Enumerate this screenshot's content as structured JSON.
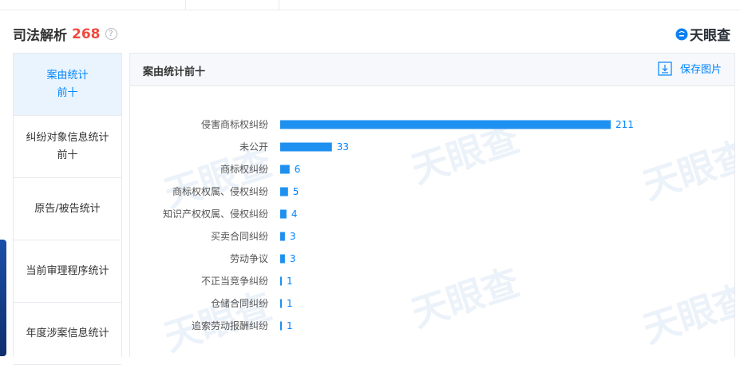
{
  "header": {
    "title": "司法解析",
    "count": "268",
    "help_glyph": "?",
    "brand_name": "天眼查",
    "brand_icon": "tianyancha-logo-icon"
  },
  "sidebar": {
    "items": [
      {
        "label": "案由统计\n前十",
        "active": true
      },
      {
        "label": "纠纷对象信息统计\n前十",
        "active": false
      },
      {
        "label": "原告/被告统计",
        "active": false
      },
      {
        "label": "当前审理程序统计",
        "active": false
      },
      {
        "label": "年度涉案信息统计",
        "active": false
      }
    ]
  },
  "panel": {
    "title": "案由统计前十",
    "save_label": "保存图片",
    "save_icon": "download-icon"
  },
  "watermark": "天眼查",
  "colors": {
    "accent": "#0084ff",
    "bar": "#1e90f0",
    "count": "#f04a3e",
    "active_bg": "#eaf4fe"
  },
  "chart_data": {
    "type": "bar",
    "orientation": "horizontal",
    "categories": [
      "侵害商标权纠纷",
      "未公开",
      "商标权纠纷",
      "商标权权属、侵权纠纷",
      "知识产权权属、侵权纠纷",
      "买卖合同纠纷",
      "劳动争议",
      "不正当竞争纠纷",
      "仓储合同纠纷",
      "追索劳动报酬纠纷"
    ],
    "values": [
      211,
      33,
      6,
      5,
      4,
      3,
      3,
      1,
      1,
      1
    ],
    "xlim": [
      0,
      211
    ],
    "grid": false,
    "legend": "none"
  }
}
